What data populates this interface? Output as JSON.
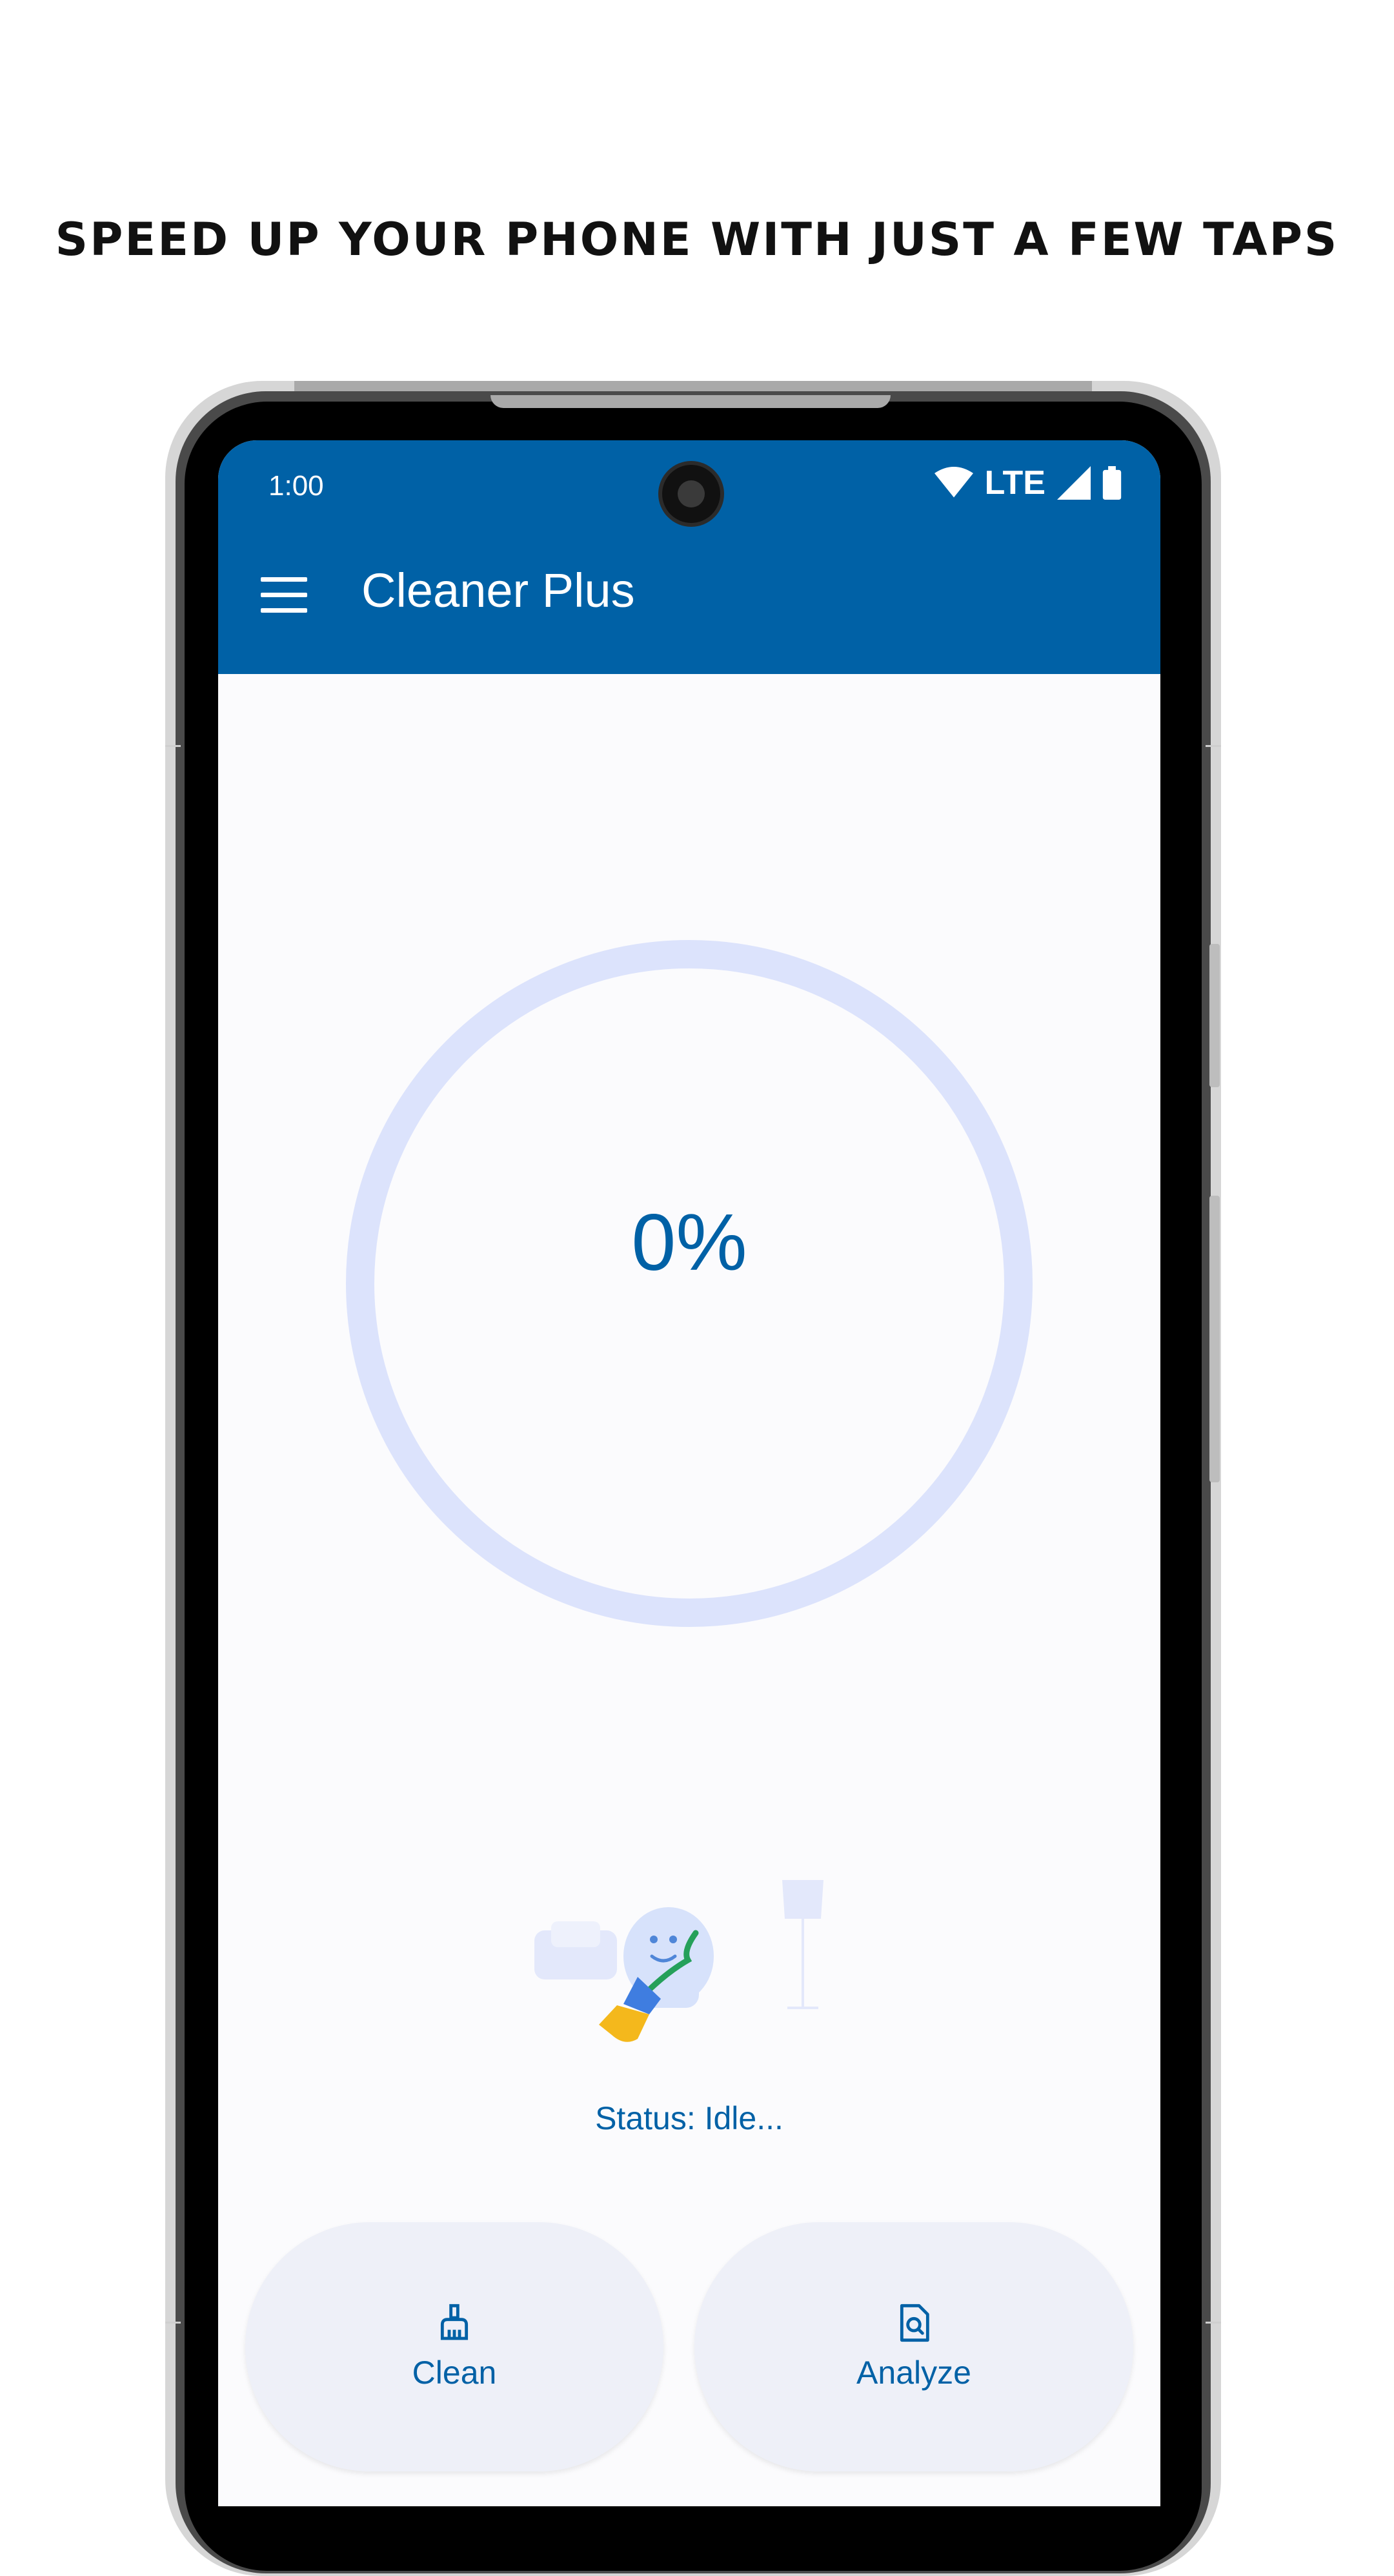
{
  "promo": {
    "headline": "SPEED UP YOUR PHONE WITH JUST A FEW TAPS"
  },
  "status_bar": {
    "time": "1:00",
    "network": "LTE",
    "icons": [
      "wifi-icon",
      "cellular-signal-icon",
      "battery-icon"
    ]
  },
  "app_bar": {
    "title": "Cleaner Plus",
    "menu_icon": "menu-icon"
  },
  "progress": {
    "value": 0,
    "label": "0%"
  },
  "status": {
    "text": "Status: Idle..."
  },
  "actions": {
    "clean_label": "Clean",
    "clean_icon": "broom-icon",
    "analyze_label": "Analyze",
    "analyze_icon": "file-search-icon"
  },
  "colors": {
    "primary": "#0061a6",
    "ring_track": "#dce3fc",
    "background": "#fbfbfd",
    "button_bg": "#eef0f8"
  }
}
